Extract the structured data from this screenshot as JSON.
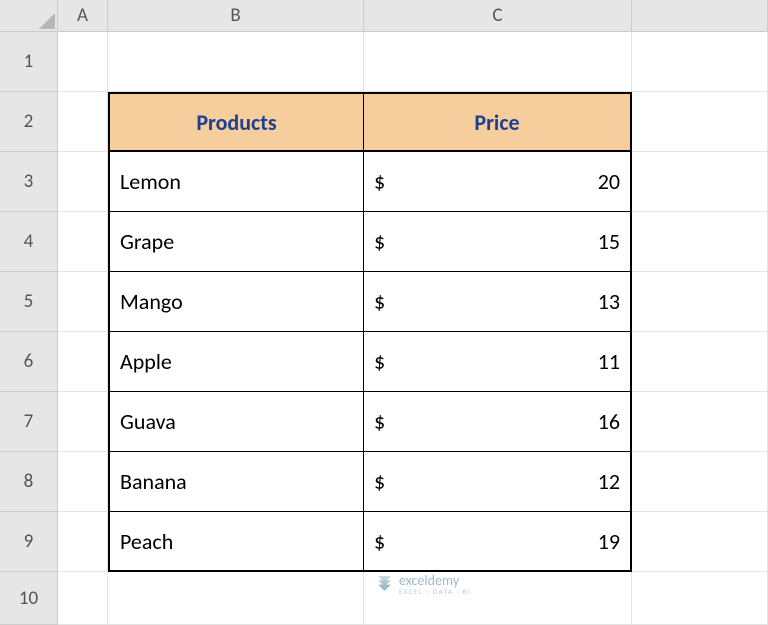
{
  "columns": [
    "A",
    "B",
    "C"
  ],
  "rows": [
    "1",
    "2",
    "3",
    "4",
    "5",
    "6",
    "7",
    "8",
    "9",
    "10"
  ],
  "table": {
    "headers": {
      "products": "Products",
      "price": "Price"
    },
    "currency": "$",
    "items": [
      {
        "name": "Lemon",
        "price": "20"
      },
      {
        "name": "Grape",
        "price": "15"
      },
      {
        "name": "Mango",
        "price": "13"
      },
      {
        "name": "Apple",
        "price": "11"
      },
      {
        "name": "Guava",
        "price": "16"
      },
      {
        "name": "Banana",
        "price": "12"
      },
      {
        "name": "Peach",
        "price": "19"
      }
    ]
  },
  "watermark": {
    "brand": "exceldemy",
    "tagline": "EXCEL · DATA · BI"
  }
}
